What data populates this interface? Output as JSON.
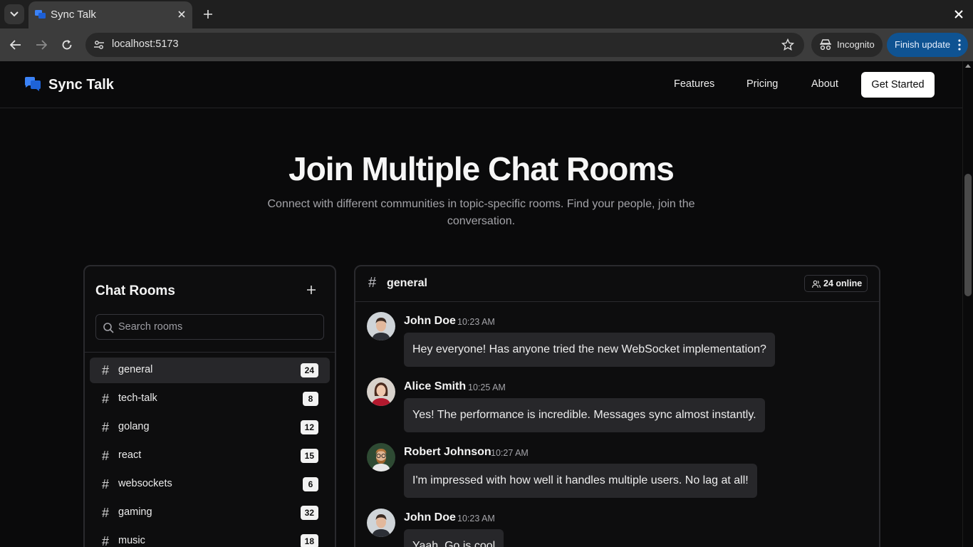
{
  "browser": {
    "tab_title": "Sync Talk",
    "url": "localhost:5173",
    "incognito_label": "Incognito",
    "finish_update_label": "Finish update",
    "accent_color": "#0f5392"
  },
  "header": {
    "brand": "Sync Talk",
    "nav": [
      "Features",
      "Pricing",
      "About"
    ],
    "cta": "Get Started"
  },
  "hero": {
    "title": "Join Multiple Chat Rooms",
    "subtitle": "Connect with different communities in topic-specific rooms. Find your people, join the conversation."
  },
  "rooms": {
    "title": "Chat Rooms",
    "search_placeholder": "Search rooms",
    "items": [
      {
        "name": "general",
        "count": "24",
        "active": true
      },
      {
        "name": "tech-talk",
        "count": "8",
        "active": false
      },
      {
        "name": "golang",
        "count": "12",
        "active": false
      },
      {
        "name": "react",
        "count": "15",
        "active": false
      },
      {
        "name": "websockets",
        "count": "6",
        "active": false
      },
      {
        "name": "gaming",
        "count": "32",
        "active": false
      },
      {
        "name": "music",
        "count": "18",
        "active": false
      }
    ]
  },
  "chat": {
    "room": "general",
    "online": "24 online",
    "messages": [
      {
        "author": "John Doe",
        "time": "10:23 AM",
        "text": "Hey everyone! Has anyone tried the new WebSocket implementation?",
        "avatar": "man-dark-hair-icon"
      },
      {
        "author": "Alice Smith",
        "time": "10:25 AM",
        "text": "Yes! The performance is incredible. Messages sync almost instantly.",
        "avatar": "woman-red-top-icon"
      },
      {
        "author": "Robert Johnson",
        "time": "10:27 AM",
        "text": "I'm impressed with how well it handles multiple users. No lag at all!",
        "avatar": "man-glasses-beard-icon"
      },
      {
        "author": "John Doe",
        "time": "10:23 AM",
        "text": "Yaah, Go is cool",
        "avatar": "man-dark-hair-icon"
      }
    ]
  }
}
